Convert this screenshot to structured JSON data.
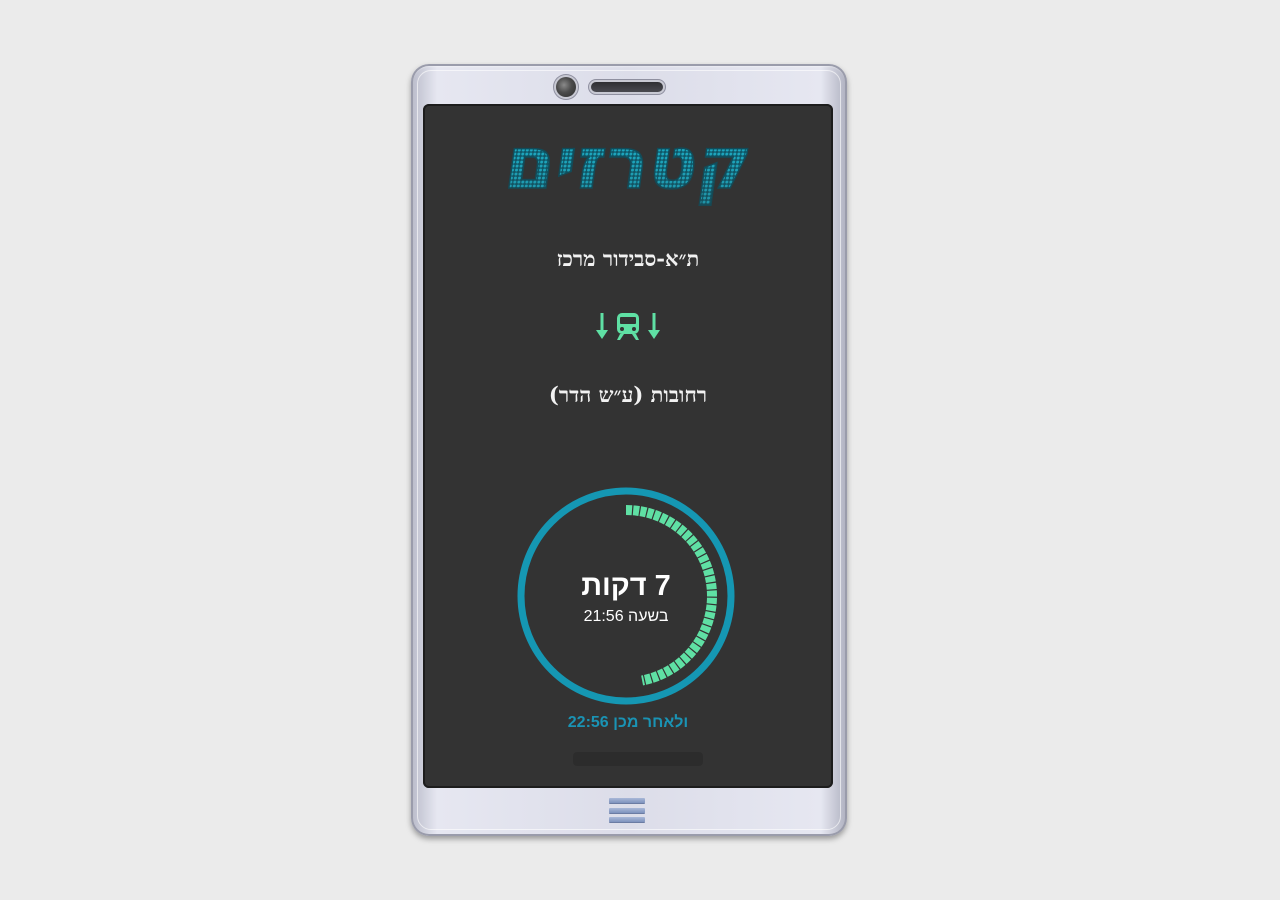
{
  "app": {
    "logo_text": "קטרזים"
  },
  "route": {
    "from": "ת״א-סבידור מרכז",
    "to": "רחובות (ע״ש הדר)"
  },
  "icons": {
    "left_arrow": "arrow-down-icon",
    "train": "train-icon",
    "right_arrow": "arrow-down-icon",
    "menu": "hamburger-menu-icon"
  },
  "timer": {
    "countdown_label": "7 דקות",
    "departure_label": "בשעה 21:56",
    "progress_fraction": 0.47
  },
  "next": {
    "label": "ולאחר מכן 22:56"
  },
  "colors": {
    "screen_bg": "#333333",
    "accent_teal": "#1597b3",
    "accent_mint": "#5fe0a4",
    "text": "#f2f2f2"
  }
}
